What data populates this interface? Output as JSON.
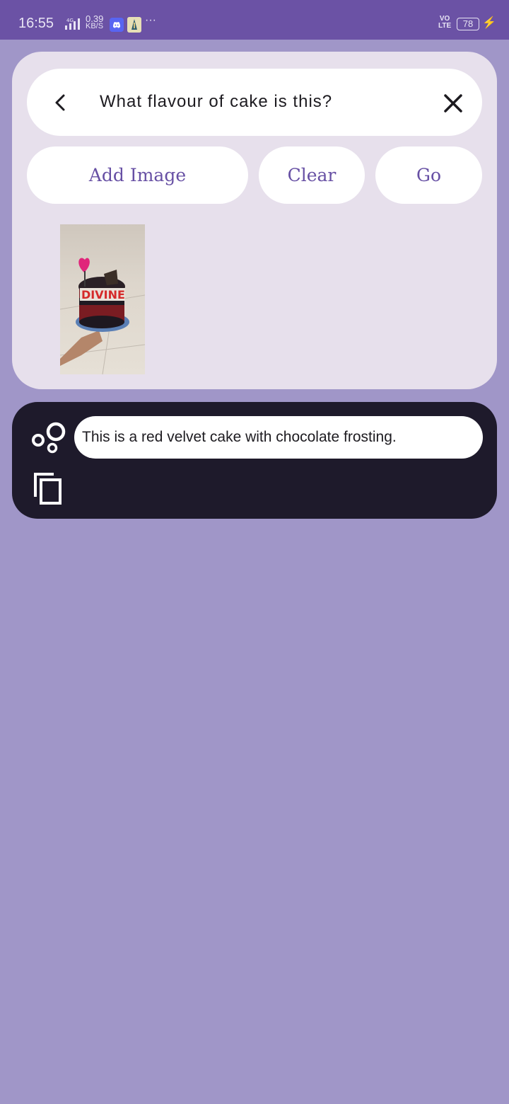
{
  "status_bar": {
    "time": "16:55",
    "network_type": "4G",
    "speed_value": "0.39",
    "speed_unit": "KB/S",
    "more_indicator": "···",
    "volte_line1": "VO",
    "volte_line2": "LTE",
    "battery": "78",
    "colors": {
      "background": "#6b52a5",
      "text": "#e8e4f4"
    }
  },
  "search": {
    "query": "What flavour of cake is this?",
    "back_icon": "chevron-left-icon",
    "clear_icon": "close-icon"
  },
  "actions": {
    "add_image_label": "Add Image",
    "clear_label": "Clear",
    "go_label": "Go"
  },
  "attachment": {
    "image_text": "DIVINE"
  },
  "answer": {
    "text": "This is a red velvet cake with chocolate frosting.",
    "assistant_icon": "bubbles-icon",
    "copy_icon": "copy-icon"
  },
  "colors": {
    "page_background": "#a096c8",
    "card_background": "#e7e0ec",
    "accent": "#6750a4",
    "answer_card": "#1e1a2b"
  }
}
